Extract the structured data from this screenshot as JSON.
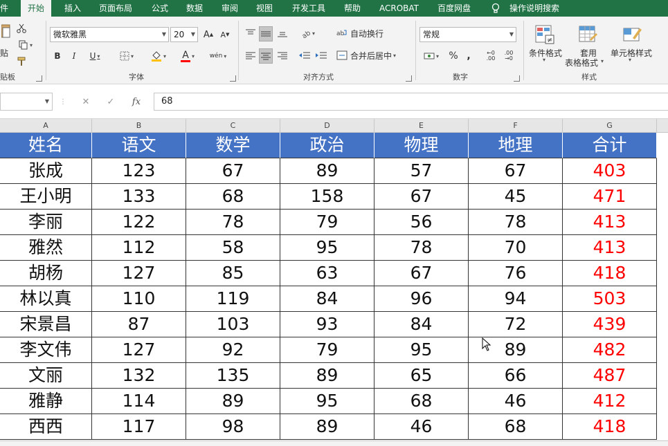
{
  "menu": {
    "tabs": [
      "件",
      "开始",
      "插入",
      "页面布局",
      "公式",
      "数据",
      "审阅",
      "视图",
      "开发工具",
      "帮助",
      "ACROBAT",
      "百度网盘"
    ],
    "active_tab": "开始",
    "tell_me": "操作说明搜索"
  },
  "ribbon": {
    "clipboard": {
      "paste_label": "贴",
      "group_label": "贴板"
    },
    "font": {
      "font_name": "微软雅黑",
      "font_size": "20",
      "grow": "A",
      "shrink": "A",
      "bold": "B",
      "italic": "I",
      "underline": "U",
      "font_color_glyph": "A",
      "phonetic": "wén",
      "group_label": "字体"
    },
    "alignment": {
      "wrap_text": "自动换行",
      "merge_center": "合并后居中",
      "group_label": "对齐方式"
    },
    "number": {
      "format": "常规",
      "percent": "%",
      "comma": ",",
      "inc_decimal": "←0 .00",
      "dec_decimal": ".00 →0",
      "group_label": "数字"
    },
    "styles": {
      "conditional_format": "条件格式",
      "table_format_line1": "套用",
      "table_format_line2": "表格格式",
      "cell_styles": "单元格样式",
      "group_label": "样式"
    }
  },
  "formula_bar": {
    "name_box": "",
    "cancel": "✕",
    "enter": "✓",
    "fx": "fx",
    "value": "68"
  },
  "columns": [
    "A",
    "B",
    "C",
    "D",
    "E",
    "F",
    "G"
  ],
  "table": {
    "headers": [
      "姓名",
      "语文",
      "数学",
      "政治",
      "物理",
      "地理",
      "合计"
    ],
    "rows": [
      [
        "张成",
        "123",
        "67",
        "89",
        "57",
        "67",
        "403"
      ],
      [
        "王小明",
        "133",
        "68",
        "158",
        "67",
        "45",
        "471"
      ],
      [
        "李丽",
        "122",
        "78",
        "79",
        "56",
        "78",
        "413"
      ],
      [
        "雅然",
        "112",
        "58",
        "95",
        "78",
        "70",
        "413"
      ],
      [
        "胡杨",
        "127",
        "85",
        "63",
        "67",
        "76",
        "418"
      ],
      [
        "林以真",
        "110",
        "119",
        "84",
        "96",
        "94",
        "503"
      ],
      [
        "宋景昌",
        "87",
        "103",
        "93",
        "84",
        "72",
        "439"
      ],
      [
        "李文伟",
        "127",
        "92",
        "79",
        "95",
        "89",
        "482"
      ],
      [
        "文丽",
        "132",
        "135",
        "89",
        "65",
        "66",
        "487"
      ],
      [
        "雅静",
        "114",
        "89",
        "95",
        "68",
        "46",
        "412"
      ],
      [
        "西西",
        "117",
        "98",
        "89",
        "46",
        "68",
        "418"
      ]
    ]
  },
  "colors": {
    "ribbon_green": "#217346",
    "header_fill": "#4472c4",
    "total_text": "#ff0000"
  }
}
